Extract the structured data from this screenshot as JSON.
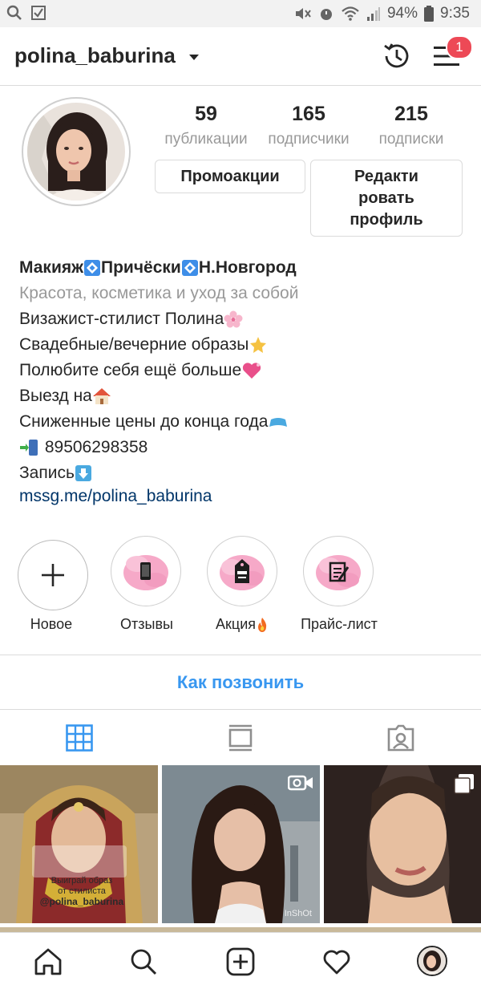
{
  "status_bar": {
    "battery": "94%",
    "time": "9:35"
  },
  "header": {
    "username": "polina_baburina",
    "notifications": "1"
  },
  "stats": [
    {
      "value": "59",
      "label": "публикации"
    },
    {
      "value": "165",
      "label": "подписчики"
    },
    {
      "value": "215",
      "label": "подписки"
    }
  ],
  "buttons": {
    "promo": "Промоакции",
    "edit_line1": "Редакти",
    "edit_line2": "ровать",
    "edit_line3": "профиль"
  },
  "bio": {
    "name_part1": "Макияж",
    "name_part2": "Причёски",
    "name_part3": "Н.Новгород",
    "category": "Красота, косметика и уход за собой",
    "line1": "Визажист-стилист Полина",
    "line2": "Свадебные/вечерние образы",
    "line3": "Полюбите себя ещё больше",
    "line4": "Выезд на",
    "line5": "Сниженные цены до конца года",
    "phone": "89506298358",
    "line7": "Запись",
    "link": "mssg.me/polina_baburina"
  },
  "highlights": [
    {
      "label": "Новое"
    },
    {
      "label": "Отзывы"
    },
    {
      "label": "Акция"
    },
    {
      "label": "Прайс-лист"
    }
  ],
  "call_button": "Как позвонить",
  "posts": [
    {
      "overlay_line1": "Выиграй образ",
      "overlay_line2": "от стилиста",
      "overlay_line3": "@polina_baburina"
    },
    {
      "watermark": "InShOt"
    },
    {}
  ],
  "colors": {
    "accent": "#3897f0",
    "badge": "#ed4956",
    "link": "#003569",
    "highlight_pink": "#f6a9c8"
  }
}
